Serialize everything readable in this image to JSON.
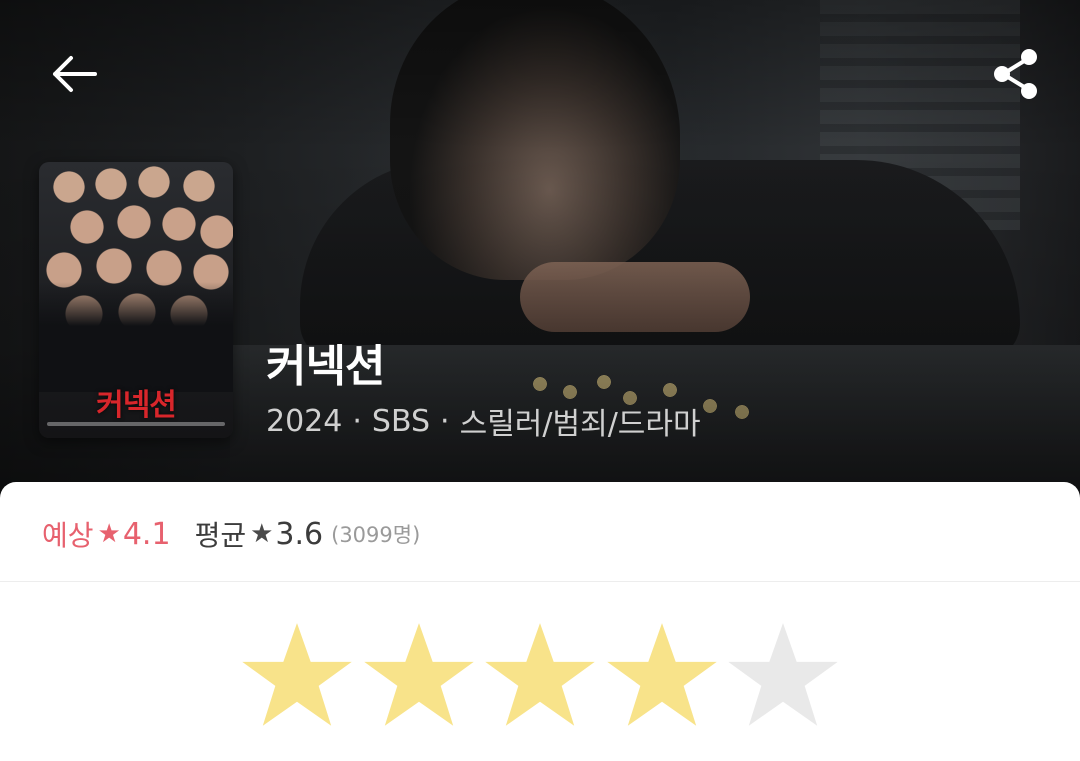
{
  "hero": {
    "title": "커넥션",
    "year": "2024",
    "network": "SBS",
    "genre": "스릴러/범죄/드라마",
    "separator": "·",
    "poster_title": "커넥션"
  },
  "rating": {
    "expected_label": "예상",
    "expected_value": "4.1",
    "average_label": "평균",
    "average_value": "3.6",
    "count": "(3099명)",
    "star_glyph": "★"
  },
  "user_rating": {
    "total_stars": 5,
    "filled_stars": 4
  },
  "colors": {
    "accent": "#e7616e",
    "star_filled": "#f8e38a",
    "star_empty": "#e9e9e9"
  },
  "icons": {
    "back": "arrow-left-icon",
    "share": "share-icon"
  }
}
